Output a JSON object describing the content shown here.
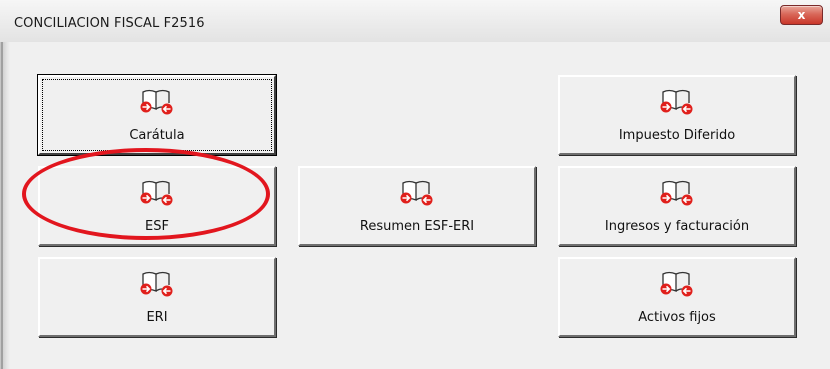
{
  "window": {
    "title": "CONCILIACION FISCAL F2516",
    "close_label": "x"
  },
  "buttons": {
    "caratula": "Carátula",
    "impuesto_diferido": "Impuesto Diferido",
    "esf": "ESF",
    "resumen": "Resumen ESF-ERI",
    "ingresos": "Ingresos y facturación",
    "eri": "ERI",
    "activos_fijos": "Activos fijos"
  },
  "icon_name": "run-macro-icon",
  "colors": {
    "annotation_ellipse": "#e2161e",
    "icon_red": "#e0201c"
  }
}
